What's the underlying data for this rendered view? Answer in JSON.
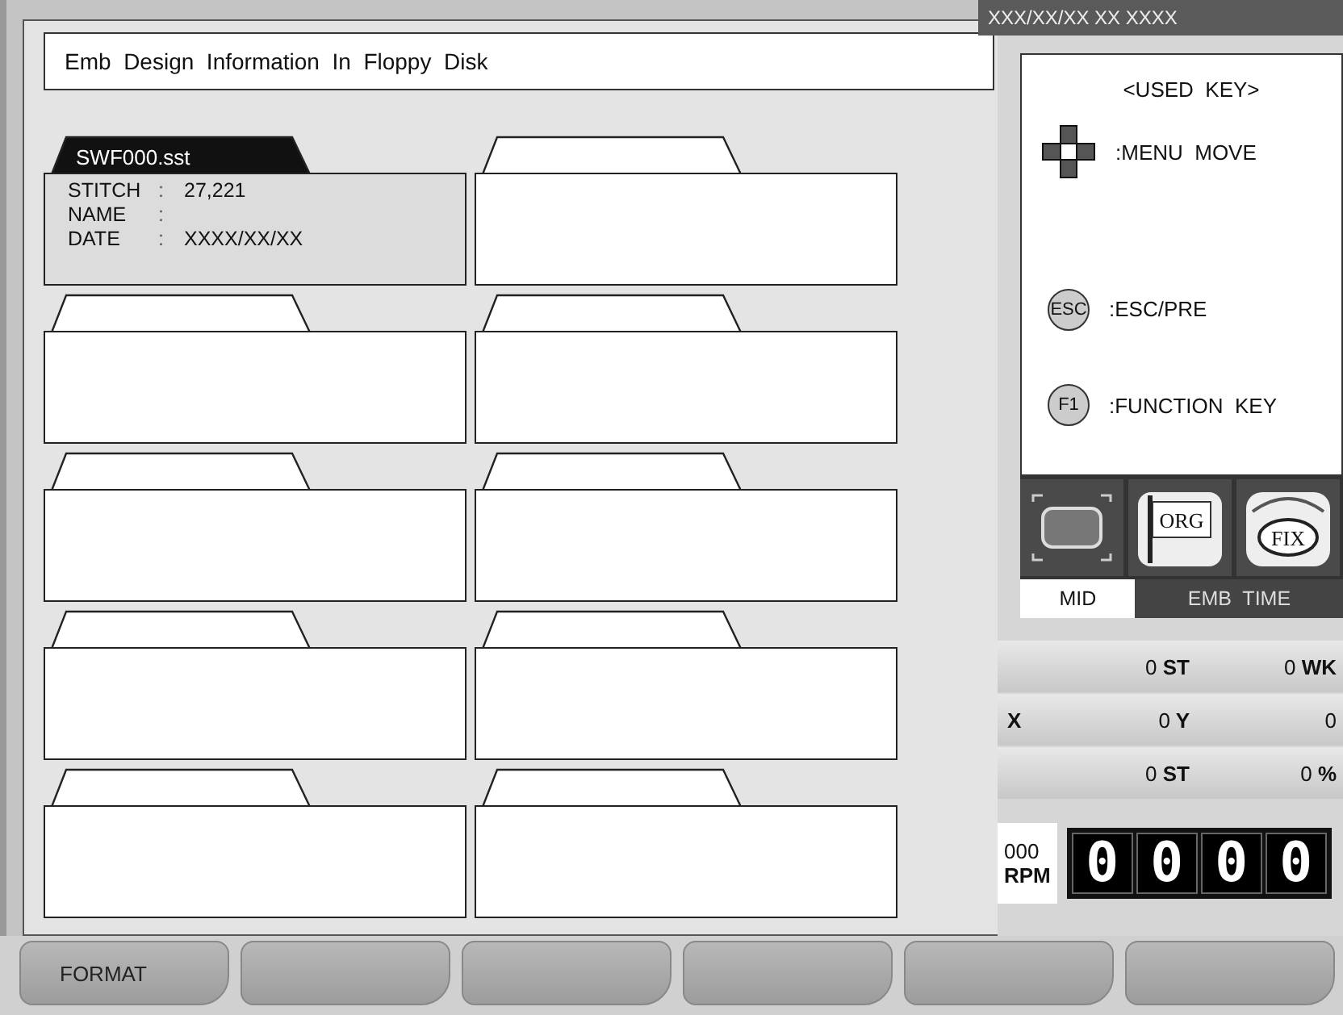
{
  "dialog": {
    "title": "Emb  Design  Information  In  Floppy  Disk",
    "folders": [
      {
        "selected": true,
        "tab": "SWF000.sst",
        "fields": [
          {
            "label": "STITCH",
            "sep": ":",
            "value": "27,221"
          },
          {
            "label": "NAME",
            "sep": ":"
          },
          {
            "label": "DATE",
            "sep": ":",
            "value": "XXXX/XX/XX"
          }
        ]
      },
      {
        "selected": false
      },
      {
        "selected": false
      },
      {
        "selected": false
      },
      {
        "selected": false
      },
      {
        "selected": false
      },
      {
        "selected": false
      },
      {
        "selected": false
      },
      {
        "selected": false
      },
      {
        "selected": false
      }
    ]
  },
  "side": {
    "datetime": "XXX/XX/XX XX XXXX",
    "used_key": {
      "title": "<USED  KEY>",
      "keys": [
        {
          "kind": "dpad",
          "desc": ":MENU  MOVE"
        },
        {
          "kind": "circle",
          "key": "ESC",
          "desc": ":ESC/PRE"
        },
        {
          "kind": "circle",
          "key": "F1",
          "desc": ":FUNCTION  KEY"
        }
      ]
    },
    "icons": [
      {
        "kind": "frame"
      },
      {
        "kind": "flag",
        "label": "ORG"
      },
      {
        "kind": "gauge",
        "label": "FIX"
      }
    ],
    "tabs": [
      {
        "label": "MID",
        "selected": true
      },
      {
        "label": "EMB  TIME",
        "selected": false
      }
    ],
    "readouts": [
      {
        "cells": [
          {
            "value": "0",
            "unit": "ST"
          },
          {
            "value": "0",
            "unit": "WK"
          }
        ]
      },
      {
        "label": "X",
        "cells": [
          {
            "value": "0",
            "unit": "Y"
          },
          {
            "value": "0"
          }
        ]
      },
      {
        "cells": [
          {
            "value": "0",
            "unit": "ST"
          },
          {
            "value": "0",
            "unit": "%"
          }
        ]
      }
    ],
    "speed": {
      "value": "000",
      "unit": "RPM",
      "digits": [
        "0",
        "0",
        "0",
        "0"
      ]
    }
  },
  "function_keys": [
    {
      "kind": "labeled",
      "label": "FORMAT"
    },
    {
      "kind": "blank"
    },
    {
      "kind": "blank"
    },
    {
      "kind": "blank"
    },
    {
      "kind": "blank"
    },
    {
      "kind": "blank"
    }
  ]
}
